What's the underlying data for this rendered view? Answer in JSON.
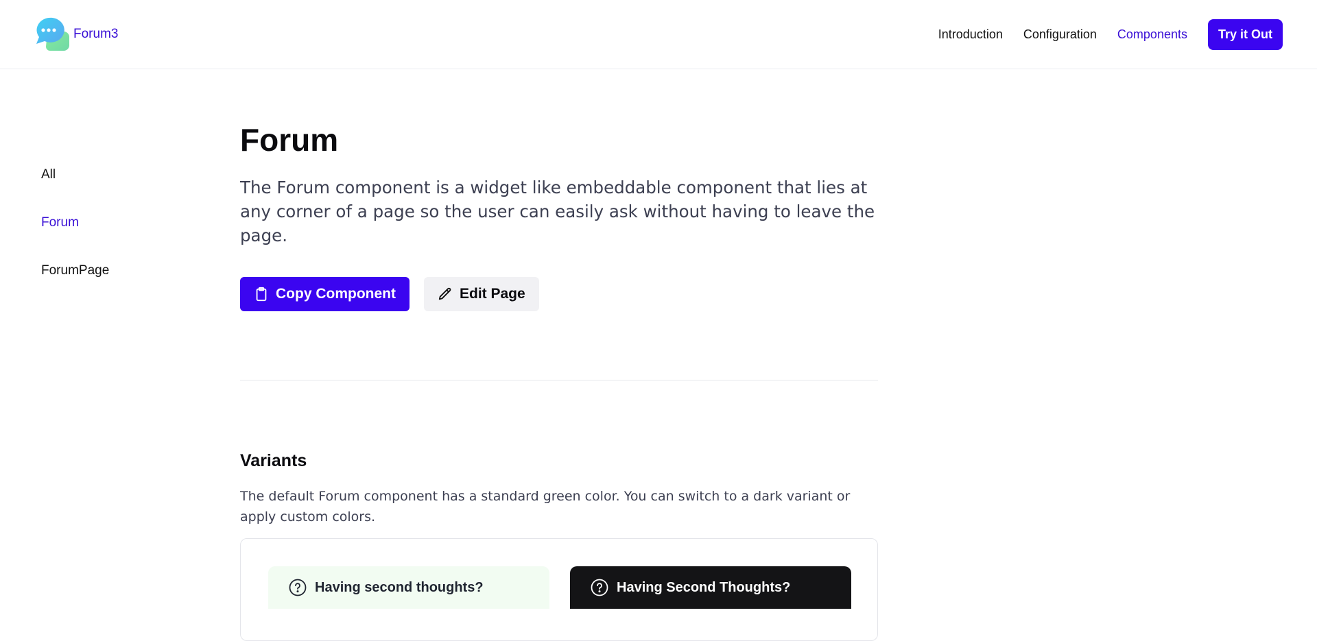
{
  "header": {
    "logo_text": "Forum3",
    "logo_icon": "chat-bubbles-icon",
    "nav": [
      {
        "label": "Introduction",
        "active": false
      },
      {
        "label": "Configuration",
        "active": false
      },
      {
        "label": "Components",
        "active": true
      }
    ],
    "cta_label": "Try it Out"
  },
  "sidebar": {
    "items": [
      {
        "label": "All",
        "active": false
      },
      {
        "label": "Forum",
        "active": true
      },
      {
        "label": "ForumPage",
        "active": false
      }
    ]
  },
  "main": {
    "title": "Forum",
    "lead": "The Forum component is a widget like embeddable component that lies at any corner of a page so the user can easily ask without having to leave the page.",
    "actions": {
      "copy_label": "Copy Component",
      "copy_icon": "clipboard-icon",
      "edit_label": "Edit Page",
      "edit_icon": "pencil-icon"
    },
    "variants": {
      "title": "Variants",
      "description": "The default Forum component has a standard green color. You can switch to a dark variant or apply custom colors.",
      "light_label": "Having second thoughts?",
      "dark_label": "Having Second Thoughts?",
      "icon": "question-circle-icon"
    }
  },
  "colors": {
    "accent": "#3b05f0",
    "accent_text": "#3a10d6",
    "light_variant_bg": "#f2fcf2",
    "dark_variant_bg": "#141416",
    "secondary_button_bg": "#f1f1f4"
  }
}
